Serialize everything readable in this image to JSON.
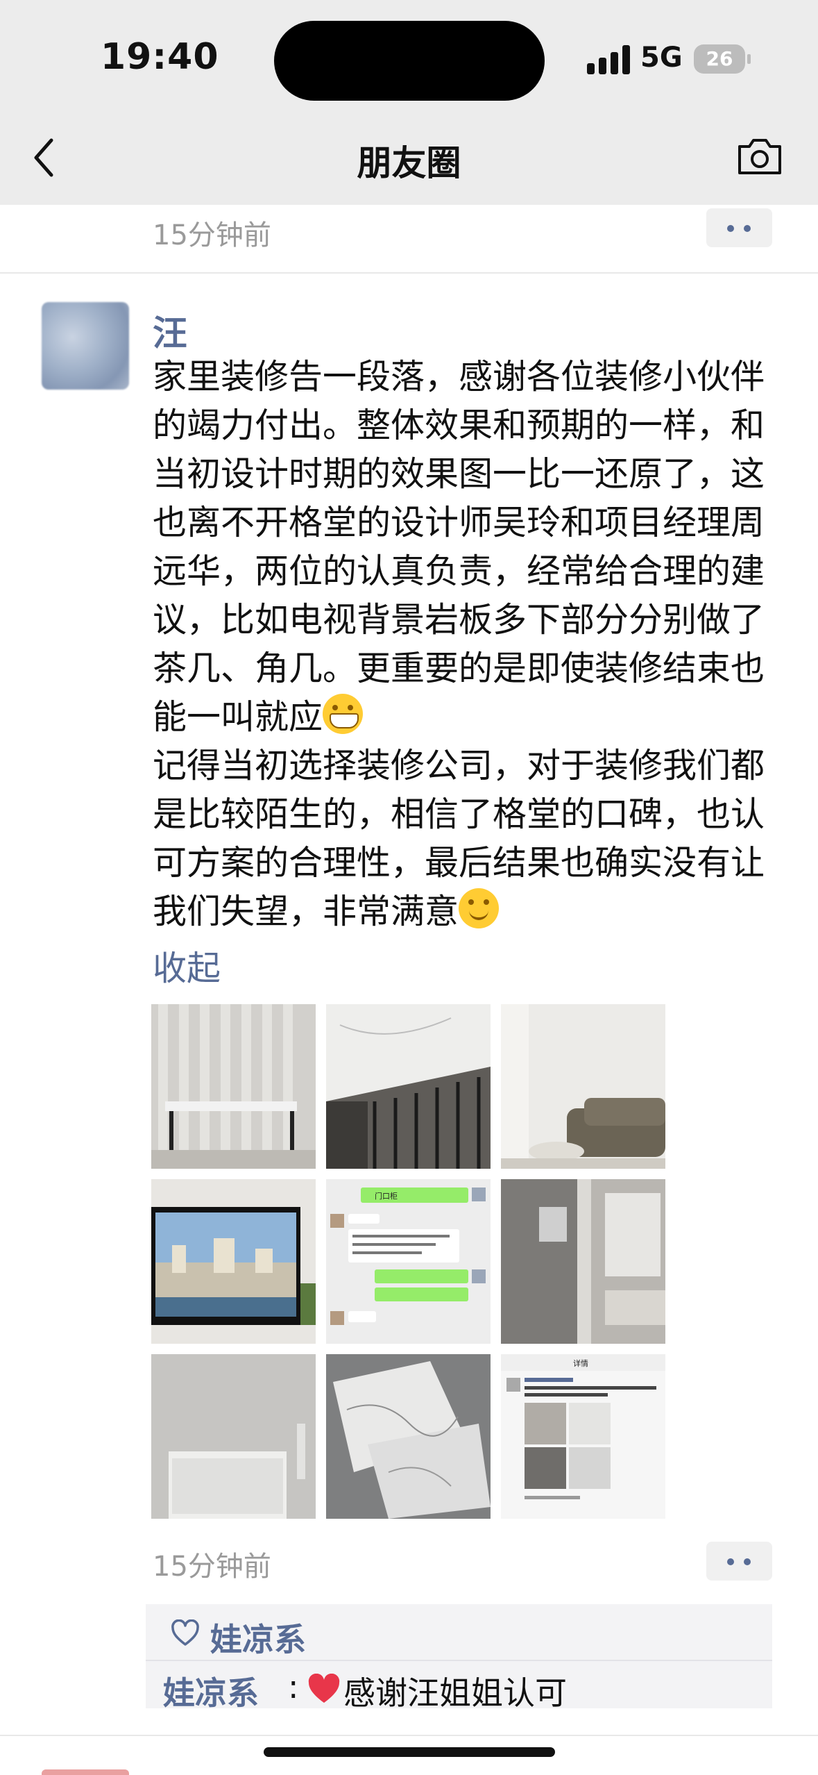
{
  "status_bar": {
    "time": "19:40",
    "network": "5G",
    "battery": "26"
  },
  "nav": {
    "title": "朋友圈"
  },
  "previous_post": {
    "timestamp": "15分钟前"
  },
  "post": {
    "author": "汪",
    "paragraph_1": "家里装修告一段落，感谢各位装修小伙伴的竭力付出。整体效果和预期的一样，和当初设计时期的效果图一比一还原了，这也离不开格堂的设计师吴玲和项目经理周远华，两位的认真负责，经常给合理的建议，比如电视背景岩板多下部分分别做了茶几、角几。更重要的是即使装修结束也能一叫就应",
    "paragraph_2": "记得当初选择装修公司，对于装修我们都是比较陌生的，相信了格堂的口碑，也认可方案的合理性，最后结果也确实没有让我们失望，非常满意",
    "collapse_label": "收起",
    "timestamp": "15分钟前",
    "images": [
      {
        "thumb1_name": "console-table-photo"
      },
      {},
      {},
      {},
      {},
      {},
      {},
      {},
      {}
    ],
    "chat_thumb_title": "门口柜",
    "detail_thumb_title": "详情",
    "likes": [
      "娃凉系"
    ],
    "comments": [
      {
        "author": "娃凉系",
        "colon": ":",
        "text": "感谢汪姐姐认可"
      }
    ]
  }
}
